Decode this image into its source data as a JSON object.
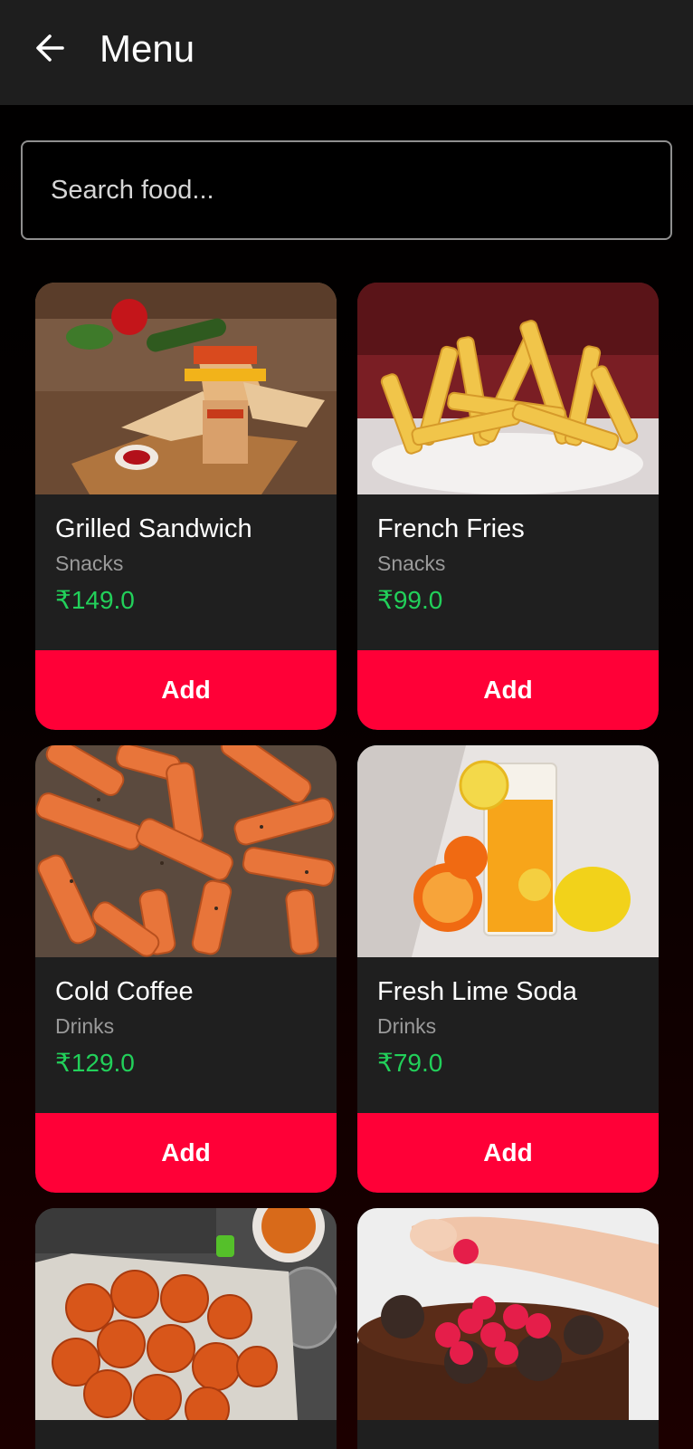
{
  "appbar": {
    "title": "Menu",
    "back_icon": "arrow-left-icon"
  },
  "search": {
    "placeholder": "Search food..."
  },
  "colors": {
    "price": "#22d05a",
    "add_button": "#ff0037",
    "card_bg": "#1f1f1f",
    "appbar_bg": "#1e1e1e"
  },
  "items": [
    {
      "name": "Grilled Sandwich",
      "category": "Snacks",
      "price": "₹149.0",
      "add_label": "Add"
    },
    {
      "name": "French Fries",
      "category": "Snacks",
      "price": "₹99.0",
      "add_label": "Add"
    },
    {
      "name": "Cold Coffee",
      "category": "Drinks",
      "price": "₹129.0",
      "add_label": "Add"
    },
    {
      "name": "Fresh Lime Soda",
      "category": "Drinks",
      "price": "₹79.0",
      "add_label": "Add"
    },
    {
      "name": "",
      "category": "",
      "price": "",
      "add_label": ""
    },
    {
      "name": "",
      "category": "",
      "price": "",
      "add_label": ""
    }
  ]
}
